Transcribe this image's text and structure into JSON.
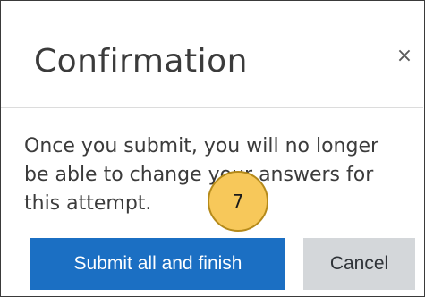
{
  "dialog": {
    "title": "Confirmation",
    "close_glyph": "×",
    "message": "Once you submit, you will no longer be able to change your answers for this attempt.",
    "buttons": {
      "submit_label": "Submit all and finish",
      "cancel_label": "Cancel"
    }
  },
  "annotation": {
    "step_number": "7"
  },
  "colors": {
    "primary": "#1b6fc3",
    "secondary": "#d4d7da",
    "badge": "#f7c85a"
  },
  "icons": {
    "close": "close-icon"
  }
}
